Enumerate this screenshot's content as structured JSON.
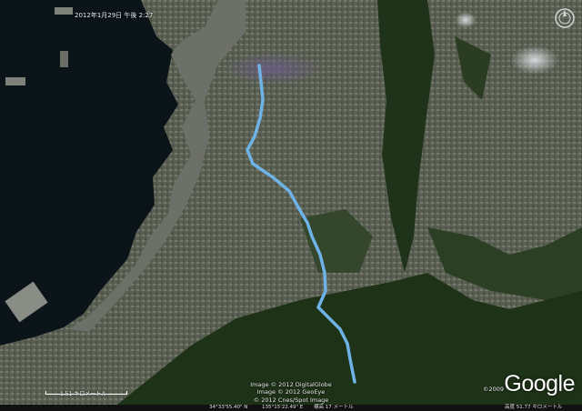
{
  "overlay": {
    "date": "2012年1月29日 午後 2:27"
  },
  "credits": {
    "line1": "Image © 2012 DigitalGlobe",
    "line2": "Image © 2012 GeoEye",
    "line3": "© 2012 Cnes/Spot Image"
  },
  "scale": {
    "label": "1.51 キロメートル"
  },
  "logo": {
    "text": "Google",
    "copyright": "©2009"
  },
  "status": {
    "lat": "34°33'55.40\" N",
    "lon": "135°15'22.49\" E",
    "elev": "標高  17 メートル",
    "altitude": "高度  51.77 キロメートル"
  },
  "colors": {
    "route": "#6fb2e6",
    "sea": "#0b1418",
    "land": "#3d4a38",
    "forest": "#1e3319"
  },
  "icons": {
    "compass": "compass-icon"
  }
}
